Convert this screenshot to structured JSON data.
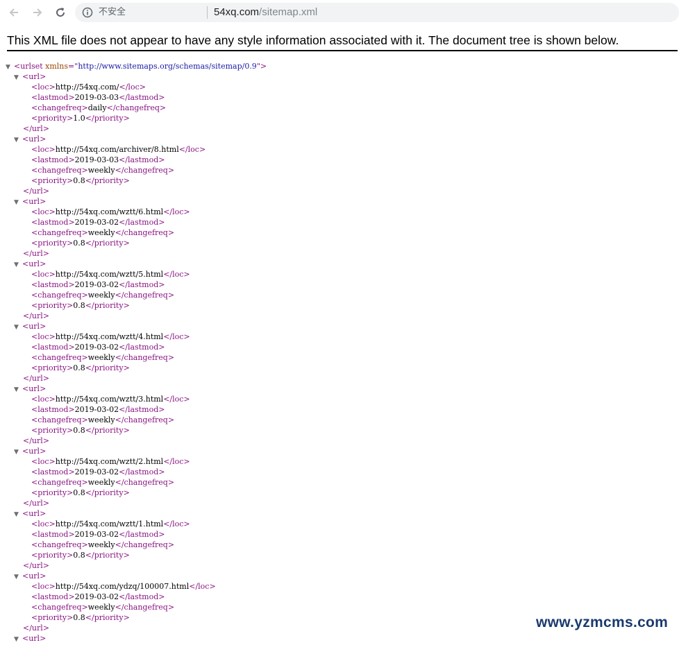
{
  "browser": {
    "security_label": "不安全",
    "url_host": "54xq.com",
    "url_path": "/sitemap.xml"
  },
  "page": {
    "warning": "This XML file does not appear to have any style information associated with it. The document tree is shown below."
  },
  "xml": {
    "root_open_tag": "urlset",
    "root_attr_name": "xmlns",
    "root_attr_value": "http://www.sitemaps.org/schemas/sitemap/0.9",
    "urls": [
      {
        "loc": "http://54xq.com/",
        "lastmod": "2019-03-03",
        "changefreq": "daily",
        "priority": "1.0"
      },
      {
        "loc": "http://54xq.com/archiver/8.html",
        "lastmod": "2019-03-03",
        "changefreq": "weekly",
        "priority": "0.8"
      },
      {
        "loc": "http://54xq.com/wztt/6.html",
        "lastmod": "2019-03-02",
        "changefreq": "weekly",
        "priority": "0.8"
      },
      {
        "loc": "http://54xq.com/wztt/5.html",
        "lastmod": "2019-03-02",
        "changefreq": "weekly",
        "priority": "0.8"
      },
      {
        "loc": "http://54xq.com/wztt/4.html",
        "lastmod": "2019-03-02",
        "changefreq": "weekly",
        "priority": "0.8"
      },
      {
        "loc": "http://54xq.com/wztt/3.html",
        "lastmod": "2019-03-02",
        "changefreq": "weekly",
        "priority": "0.8"
      },
      {
        "loc": "http://54xq.com/wztt/2.html",
        "lastmod": "2019-03-02",
        "changefreq": "weekly",
        "priority": "0.8"
      },
      {
        "loc": "http://54xq.com/wztt/1.html",
        "lastmod": "2019-03-02",
        "changefreq": "weekly",
        "priority": "0.8"
      },
      {
        "loc": "http://54xq.com/ydzq/100007.html",
        "lastmod": "2019-03-02",
        "changefreq": "weekly",
        "priority": "0.8"
      }
    ]
  },
  "watermark": "www.yzmcms.com",
  "icons": {
    "back": "back-arrow-icon",
    "forward": "forward-arrow-icon",
    "reload": "reload-icon",
    "info": "info-icon",
    "caret": "expand-caret-icon"
  },
  "colors": {
    "tag": "#881280",
    "attr_name": "#994500",
    "attr_value": "#1a1aa6",
    "omnibox_bg": "#f1f3f4",
    "watermark": "#1a3a6e"
  }
}
